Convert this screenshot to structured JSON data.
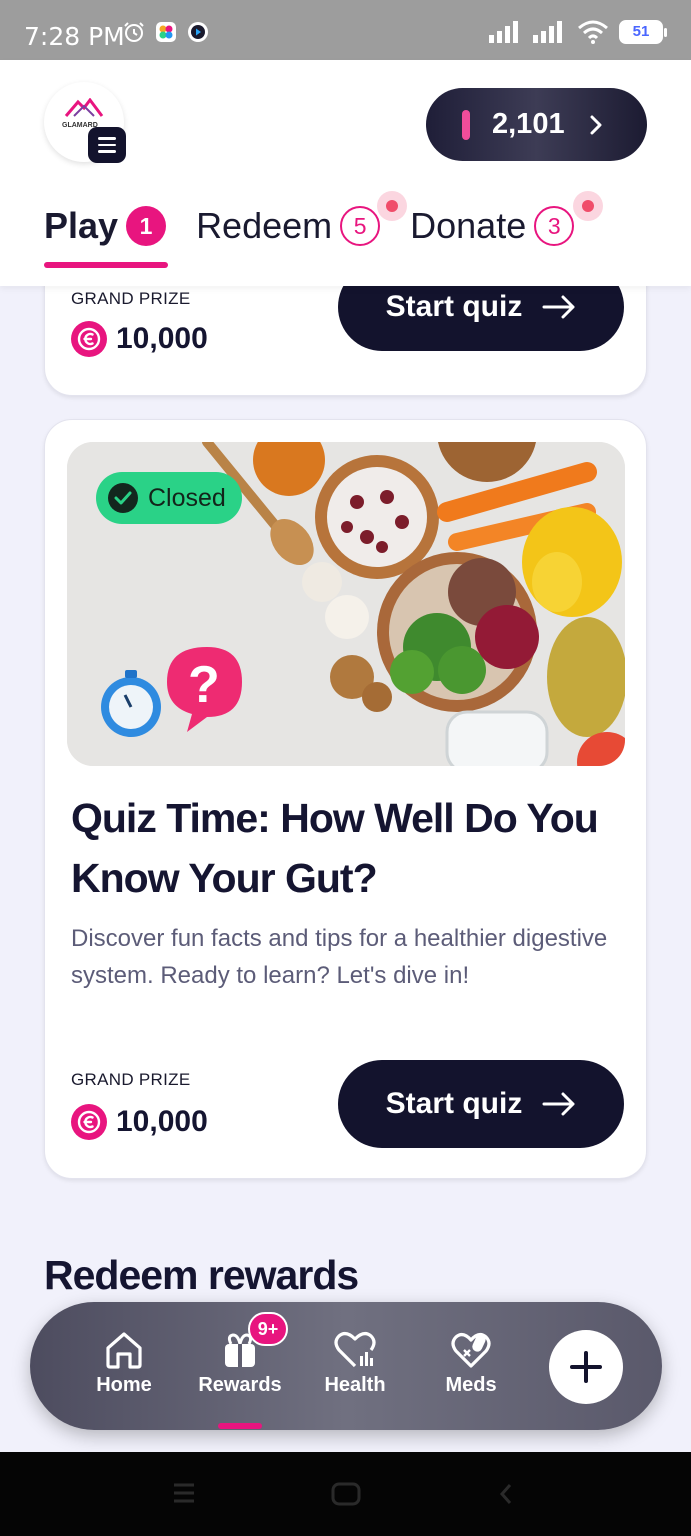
{
  "status_bar": {
    "time": "7:28 PM",
    "battery": "51",
    "icons": [
      "alarm-icon",
      "app-icon",
      "media-icon",
      "signal-icon",
      "wifi-icon",
      "battery-icon"
    ]
  },
  "header": {
    "logo_text": "GLAMARD",
    "points": "2,101",
    "tabs": [
      {
        "label": "Play",
        "count": "1"
      },
      {
        "label": "Redeem",
        "count": "5"
      },
      {
        "label": "Donate",
        "count": "3"
      }
    ]
  },
  "quiz_cards": [
    {
      "prize_label": "GRAND PRIZE",
      "prize_value": "10,000",
      "button_label": "Start quiz"
    },
    {
      "status": "Closed",
      "title": "Quiz Time: How Well Do You Know Your Gut?",
      "description": "Discover fun facts and tips for a healthier digestive system. Ready to learn? Let's dive in!",
      "prize_label": "GRAND PRIZE",
      "prize_value": "10,000",
      "button_label": "Start quiz"
    }
  ],
  "section": {
    "title": "Redeem rewards"
  },
  "bottom_nav": {
    "items": [
      {
        "label": "Home",
        "icon": "home-icon"
      },
      {
        "label": "Rewards",
        "icon": "gift-icon",
        "badge": "9+"
      },
      {
        "label": "Health",
        "icon": "heart-chart-icon"
      },
      {
        "label": "Meds",
        "icon": "pill-heart-icon"
      }
    ],
    "add_icon": "plus-icon"
  },
  "colors": {
    "accent": "#e8157f",
    "dark": "#13132d",
    "closed": "#2ad287"
  }
}
